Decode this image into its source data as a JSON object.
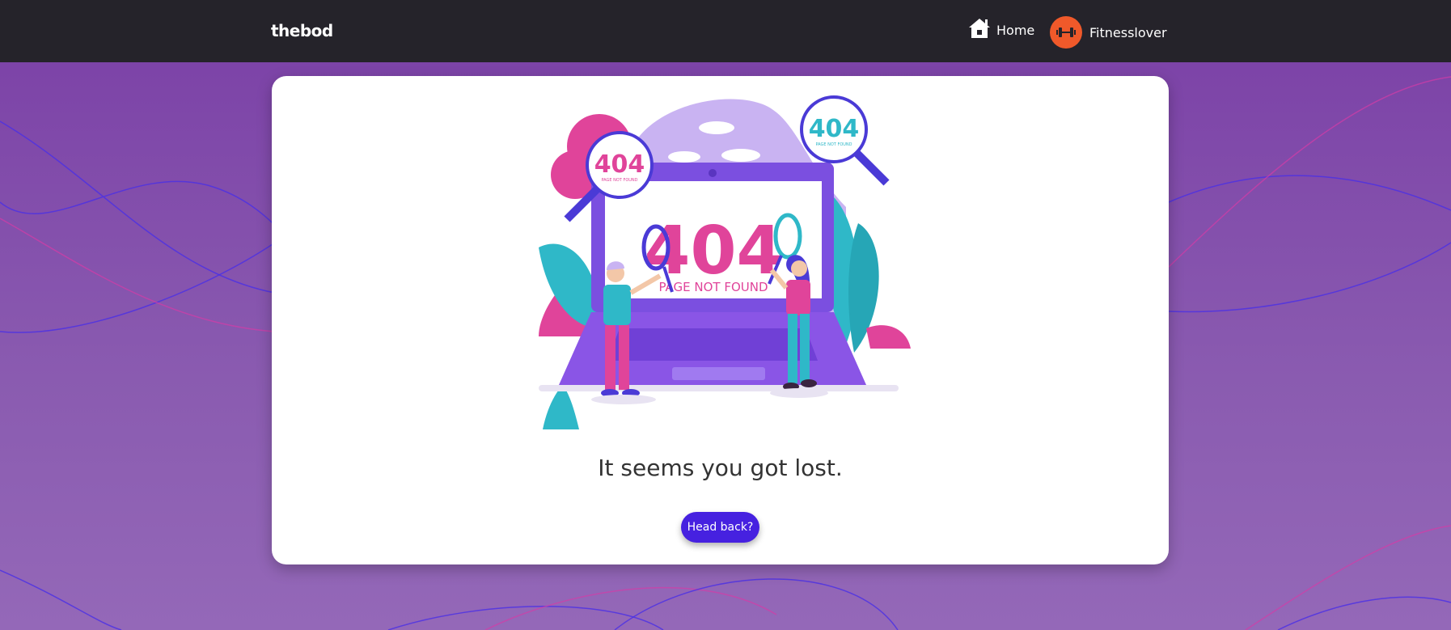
{
  "header": {
    "brand": "thebod",
    "nav": {
      "home_label": "Home",
      "user_label": "Fitnesslover"
    }
  },
  "main": {
    "illustration": {
      "big_code": "404",
      "big_caption": "PAGE NOT FOUND",
      "lens_left_code": "404",
      "lens_left_caption": "PAGE NOT FOUND",
      "lens_right_code": "404",
      "lens_right_caption": "PAGE NOT FOUND"
    },
    "message": "It seems you got lost.",
    "back_button_label": "Head back?"
  },
  "colors": {
    "topbar": "#25232a",
    "background": "#7a3fa6",
    "accent_button": "#4621e0",
    "avatar": "#f0592a",
    "pink": "#e0449a",
    "teal": "#2fb8c8",
    "purple": "#8a55e6"
  },
  "icons": {
    "home": "home-icon",
    "avatar": "dumbbell-icon"
  }
}
